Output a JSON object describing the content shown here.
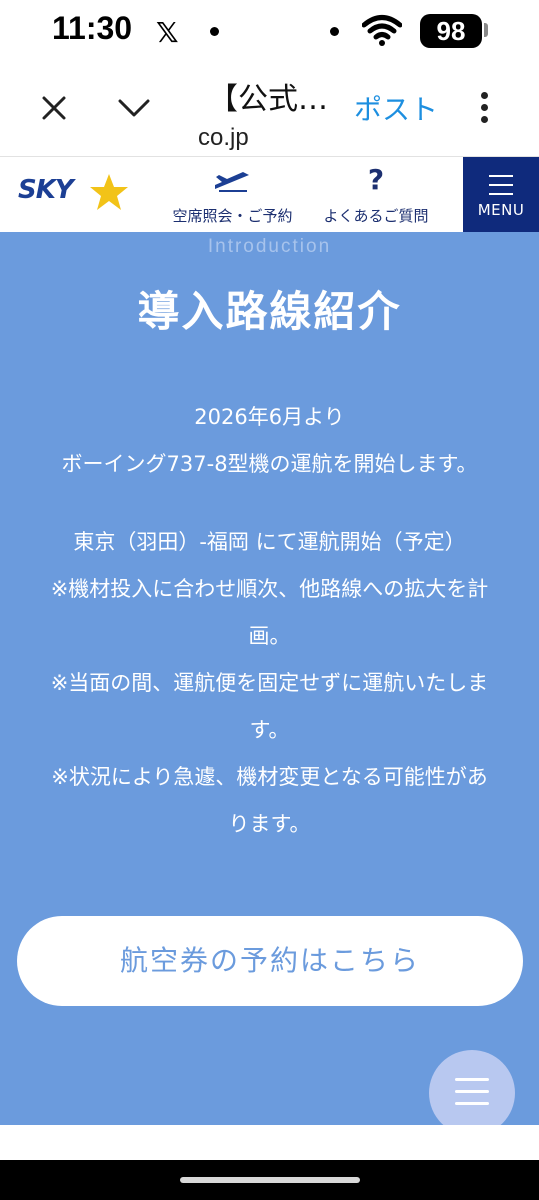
{
  "status_bar": {
    "time": "11:30",
    "x_logo": "𝕏",
    "battery": "98"
  },
  "browser": {
    "tab_title": "【公式…",
    "url": "co.jp",
    "post_label": "ポスト"
  },
  "site_header": {
    "logo_text": "SKY",
    "nav": [
      {
        "label": "空席照会・ご予約",
        "icon": "airplane-icon"
      },
      {
        "label": "よくあるご質問",
        "icon": "question-icon",
        "glyph": "?"
      }
    ],
    "menu_label": "MENU"
  },
  "hero": {
    "eyebrow": "Introduction",
    "title": "導入路線紹介",
    "lines": [
      "2026年6月より",
      "ボーイング737-8型機の運航を開始します。",
      "東京（羽田）-福岡 にて運航開始（予定）",
      "※機材投入に合わせ順次、他路線への拡大を計",
      "画。",
      "※当面の間、運航便を固定せずに運航いたしま",
      "す。",
      "※状況により急遽、機材変更となる可能性があ",
      "ります。"
    ],
    "cta_label": "航空券の予約はこちら"
  },
  "colors": {
    "hero_bg": "#6b9bdd",
    "brand_navy": "#0f2a7c",
    "logo_star": "#f2c318",
    "post_blue": "#1d8fe0"
  }
}
